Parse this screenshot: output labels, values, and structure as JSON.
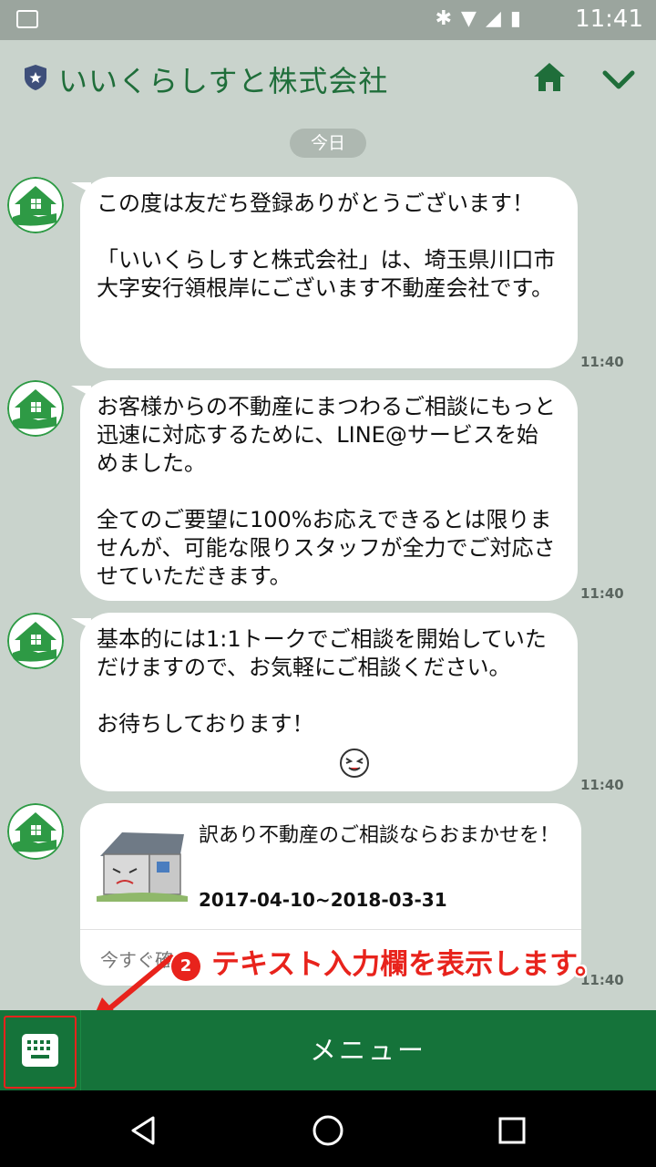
{
  "status_bar": {
    "time": "11:41"
  },
  "header": {
    "title": "いいくらしすと株式会社"
  },
  "date_divider": "今日",
  "messages": [
    {
      "text": "この度は友だち登録ありがとうございます！\n\n「いいくらしすと株式会社」は、埼玉県川口市大字安行領根岸にございます不動産会社です。",
      "time": "11:40"
    },
    {
      "text": "お客様からの不動産にまつわるご相談にもっと迅速に対応するために、LINE@サービスを始めました。\n\n全てのご要望に100%お応えできるとは限りませんが、可能な限りスタッフが全力でご対応させていただきます。",
      "time": "11:40"
    },
    {
      "text": "基本的には1:1トークでご相談を開始していただけますので、お気軽にご相談ください。\n\nお待ちしております！",
      "time": "11:40"
    }
  ],
  "card": {
    "title": "訳あり不動産のご相談ならおまかせを！",
    "date_range": "2017-04-10~2018-03-31",
    "link": "今すぐ確",
    "time": "11:40"
  },
  "annotation": {
    "number": "2",
    "text": "テキスト入力欄を表示します。"
  },
  "menu": {
    "label": "メニュー"
  },
  "colors": {
    "brand_green": "#15733a",
    "header_green": "#1f6e3a",
    "background": "#c9d3cc",
    "annotation_red": "#e8231c"
  }
}
